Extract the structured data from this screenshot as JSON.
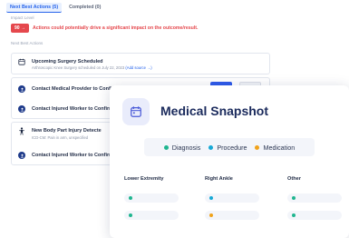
{
  "tabs": [
    {
      "label": "Next Best Actions (5)"
    },
    {
      "label": "Completed (0)"
    }
  ],
  "impact": {
    "label": "Impact Level",
    "badge": "90 →",
    "text": "Actions could potentially drive a significant impact on the outcome/result."
  },
  "next_best_label": "Next Best Actions",
  "actions": [
    {
      "title": "Upcoming Surgery Scheduled",
      "subtitle": "Arthroscopic Knee Surgery scheduled on July 22, 2023",
      "link": "(Add source →)",
      "icon": "calendar-icon"
    },
    {
      "title": "Contact Medical Provider to Confirm Surgery and Next ap",
      "icon": "user-icon"
    },
    {
      "title": "Contact Injured Worker to Confirm",
      "icon": "user-icon"
    },
    {
      "title": "New Body Part Injury Detecte",
      "subtitle": "ICD-CM: Pain in arm, unspecified",
      "icon": "body-icon"
    },
    {
      "title": "Contact Injured Worker to Confirm",
      "icon": "user-icon"
    }
  ],
  "snapshot": {
    "title": "Medical Snapshot",
    "legend": [
      {
        "label": "Diagnosis",
        "color": "#1fb58f"
      },
      {
        "label": "Procedure",
        "color": "#17a9d6"
      },
      {
        "label": "Medication",
        "color": "#f0a21a"
      }
    ],
    "columns": [
      {
        "header": "Lower Extremity",
        "dots": [
          "#1fb58f",
          "#1fb58f"
        ]
      },
      {
        "header": "Right Ankle",
        "dots": [
          "#17a9d6",
          "#f0a21a"
        ]
      },
      {
        "header": "Other",
        "dots": [
          "#1fb58f",
          "#1fb58f"
        ]
      }
    ]
  }
}
